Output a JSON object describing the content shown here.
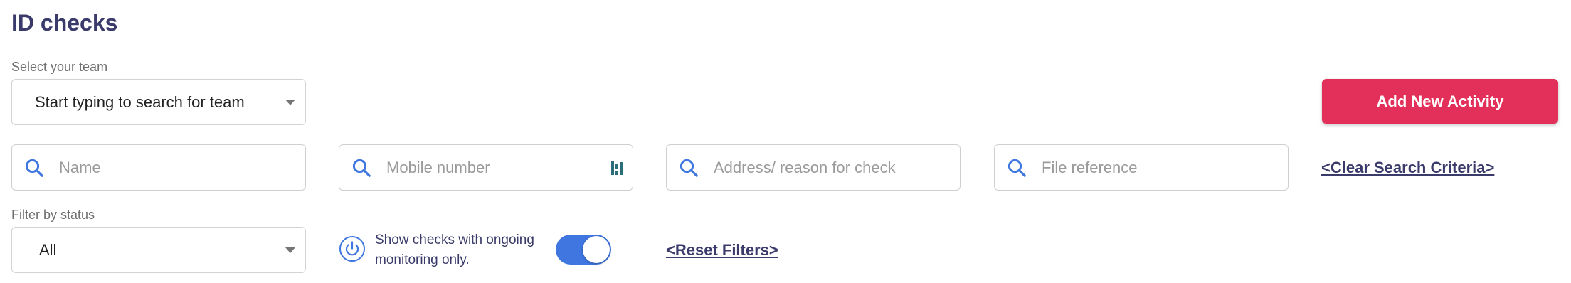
{
  "page": {
    "title": "ID checks"
  },
  "team": {
    "label": "Select your team",
    "placeholder": "Start typing to search for team"
  },
  "actions": {
    "add_activity_label": "Add New Activity",
    "clear_search_label": "<Clear Search Criteria>",
    "reset_filters_label": "<Reset Filters>"
  },
  "search": {
    "name_placeholder": "Name",
    "mobile_placeholder": "Mobile number",
    "address_placeholder": "Address/ reason for check",
    "file_placeholder": "File reference"
  },
  "status_filter": {
    "label": "Filter by status",
    "selected": "All"
  },
  "monitoring": {
    "text": "Show checks with ongoing monitoring only.",
    "enabled": true
  },
  "colors": {
    "accent": "#e3305a",
    "toggle_on": "#3f76e0",
    "link": "#3b3b6b",
    "search_icon": "#3f76e0"
  },
  "icons": {
    "search": "search-icon",
    "power": "power-icon",
    "keyboard": "keyboard-icon",
    "dropdown": "chevron-down-icon"
  }
}
